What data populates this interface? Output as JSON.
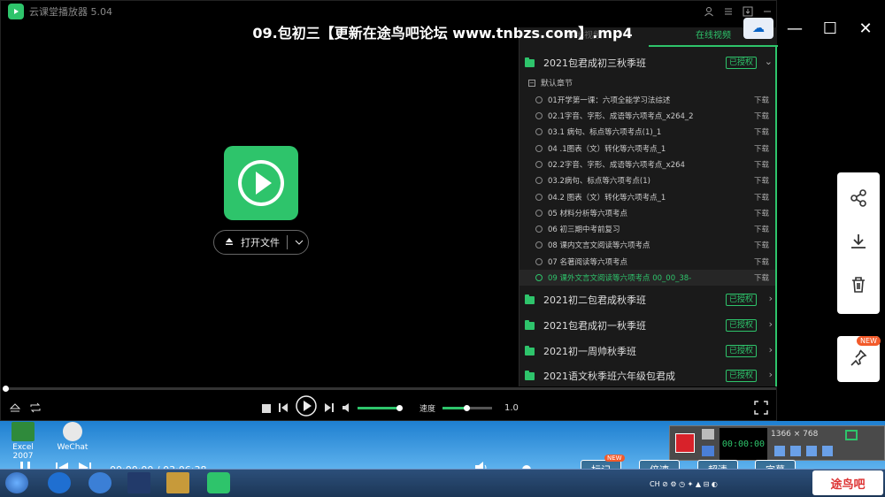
{
  "app": {
    "name": "云课堂播放器 5.04",
    "title": "09.包初三【更新在途鸟吧论坛 www.tnbzs.com】.mp4"
  },
  "center": {
    "open_label": "打开文件"
  },
  "panel": {
    "tabs": [
      "本地视频",
      "在线视频"
    ],
    "section": "默认章节",
    "courses": [
      {
        "name": "2021包君成初三秋季班",
        "badge": "已授权",
        "expanded": true
      },
      {
        "name": "2021初二包君成秋季班",
        "badge": "已授权"
      },
      {
        "name": "2021包君成初一秋季班",
        "badge": "已授权"
      },
      {
        "name": "2021初一周帅秋季班",
        "badge": "已授权"
      },
      {
        "name": "2021语文秋季班六年级包君成",
        "badge": "已授权"
      }
    ],
    "lessons": [
      {
        "name": "01开学第一课：六项全能学习法综述",
        "action": "下载"
      },
      {
        "name": "02.1字音、字形、成语等六项考点_x264_2",
        "action": "下载"
      },
      {
        "name": "03.1 病句、标点等六项考点(1)_1",
        "action": "下载"
      },
      {
        "name": "04 .1图表（文）转化等六项考点_1",
        "action": "下载"
      },
      {
        "name": "02.2字音、字形、成语等六项考点_x264",
        "action": "下载"
      },
      {
        "name": "03.2病句、标点等六项考点(1)",
        "action": "下载"
      },
      {
        "name": "04.2 图表（文）转化等六项考点_1",
        "action": "下载"
      },
      {
        "name": "05 材料分析等六项考点",
        "action": "下载"
      },
      {
        "name": "06 初三期中考前复习",
        "action": "下载"
      },
      {
        "name": "08 课内文言文阅读等六项考点",
        "action": "下载"
      },
      {
        "name": "07 名著阅读等六项考点",
        "action": "下载"
      },
      {
        "name": "09 课外文言文阅读等六项考点 00_00_38-",
        "action": "下载",
        "current": true
      }
    ]
  },
  "controls": {
    "speed_label": "速度",
    "speed_value": "1.0",
    "volume": 0.8
  },
  "outer": {
    "time": "00:00:00 / 03:06:38",
    "btn_mark": "标记",
    "btn_mark_tag": "NEW",
    "btn_speed": "倍速",
    "btn_quality": "超清",
    "btn_subtitle": "字幕",
    "side_new": "NEW"
  },
  "desktop": {
    "icons": [
      "Excel 2007",
      "WeChat"
    ]
  },
  "recorder": {
    "resolution": "1366 × 768"
  },
  "watermark": "途鸟吧"
}
